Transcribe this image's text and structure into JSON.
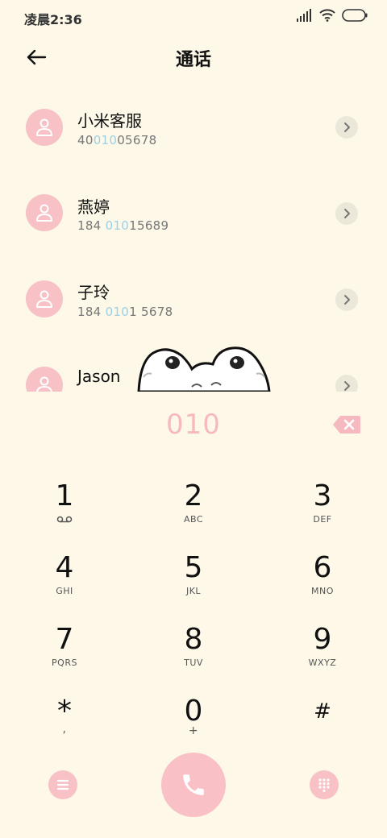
{
  "status_bar": {
    "time": "凌晨2:36",
    "icons": [
      "signal-icon",
      "wifi-icon",
      "battery-icon"
    ]
  },
  "header": {
    "title": "通话",
    "back_icon": "arrow-left-icon"
  },
  "contacts": [
    {
      "name": "小米客服",
      "number_parts": [
        "40",
        "010",
        "05678"
      ]
    },
    {
      "name": "燕婷",
      "number_parts": [
        "184 ",
        "010",
        "15689"
      ]
    },
    {
      "name": "子玲",
      "number_parts": [
        "184 ",
        "010",
        "1 5678"
      ]
    },
    {
      "name": "Jason",
      "number_parts": [
        "",
        "",
        ""
      ]
    }
  ],
  "dial": {
    "number": "010",
    "delete_icon": "backspace-icon"
  },
  "keypad": [
    {
      "digit": "1",
      "letters": "",
      "icon": "voicemail-icon"
    },
    {
      "digit": "2",
      "letters": "ABC"
    },
    {
      "digit": "3",
      "letters": "DEF"
    },
    {
      "digit": "4",
      "letters": "GHI"
    },
    {
      "digit": "5",
      "letters": "JKL"
    },
    {
      "digit": "6",
      "letters": "MNO"
    },
    {
      "digit": "7",
      "letters": "PQRS"
    },
    {
      "digit": "8",
      "letters": "TUV"
    },
    {
      "digit": "9",
      "letters": "WXYZ"
    },
    {
      "digit": "*",
      "letters": ","
    },
    {
      "digit": "0",
      "letters": "+"
    },
    {
      "digit": "#",
      "letters": ""
    }
  ],
  "bottom_bar": {
    "menu_icon": "menu-icon",
    "call_icon": "phone-icon",
    "keypad_icon": "dialpad-icon"
  },
  "colors": {
    "background": "#fdf8e8",
    "accent_pink": "#f7c1c6",
    "dial_number": "#f7b9c0",
    "highlight_blue": "#9dd0e6"
  }
}
